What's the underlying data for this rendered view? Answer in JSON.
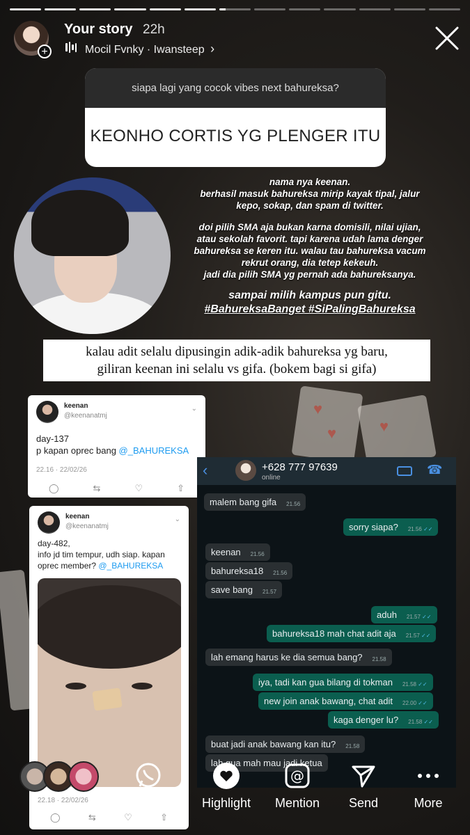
{
  "header": {
    "title": "Your story",
    "time": "22h",
    "music": "Mocil Fvnky · Iwansteep",
    "music_chevron": "›"
  },
  "progress": {
    "segments": 13,
    "completed": 6,
    "active_fraction": 0.2
  },
  "question_sticker": {
    "question": "siapa lagi yang cocok vibes next bahureksa?",
    "answer": "KEONHO CORTIS YG PLENGER ITU"
  },
  "description": {
    "p1": [
      "nama nya keenan.",
      "berhasil masuk bahureksa mirip kayak tipal, jalur",
      "kepo, sokap, dan spam di twitter."
    ],
    "p2": [
      "doi pilih SMA aja bukan karna domisili, nilai ujian,",
      "atau sekolah favorit. tapi karena udah lama denger",
      "bahureksa se keren itu. walau tau bahureksa vacum",
      "rekrut orang, dia tetep kekeuh.",
      "jadi dia pilih SMA yg pernah ada bahureksanya."
    ],
    "p3": "sampai milih kampus pun gitu.",
    "tags": "#BahureksaBanget #SiPalingBahureksa"
  },
  "caption": [
    "kalau adit selalu dipusingin adik-adik bahureksa yg baru,",
    "giliran keenan ini selalu vs gifa. (bokem bagi si gifa)"
  ],
  "tweet1": {
    "name": "keenan",
    "handle": "@keenanatmj",
    "line1": "day-137",
    "text": "p kapan oprec bang ",
    "mention": "@_BAHUREKSA",
    "meta": "22.16 · 22/02/26"
  },
  "tweet2": {
    "name": "keenan",
    "handle": "@keenanatmj",
    "line1": "day-482,",
    "line2": "info jd tim tempur, udh siap. kapan",
    "line3": "oprec member? ",
    "mention": "@_BAHUREKSA",
    "meta": "22.18 · 22/02/26"
  },
  "whatsapp": {
    "number": "+628 777 97639",
    "status": "online",
    "messages": [
      {
        "text": "malem bang gifa",
        "time": "21.56"
      },
      {
        "text": "sorry siapa?",
        "time": "21.56"
      },
      {
        "text": "keenan",
        "time": "21.56"
      },
      {
        "text": "bahureksa18",
        "time": "21.56"
      },
      {
        "text": "save bang",
        "time": "21.57"
      },
      {
        "text": "aduh",
        "time": "21.57"
      },
      {
        "text": "bahureksa18 mah chat adit aja",
        "time": "21.57"
      },
      {
        "text": "lah emang harus ke dia semua bang?",
        "time": "21.58"
      },
      {
        "text": "iya, tadi kan gua bilang di tokman",
        "time": "21.58"
      },
      {
        "text": "new join anak bawang, chat adit",
        "time": "22.00"
      },
      {
        "text": "kaga denger lu?",
        "time": "21.58"
      },
      {
        "text": "buat jadi anak bawang kan itu?",
        "time": "21.58"
      },
      {
        "text": "lah gua mah mau jadi ketua",
        "time": ""
      }
    ]
  },
  "actions": {
    "highlight": "Highlight",
    "mention": "Mention",
    "send": "Send",
    "more": "More"
  },
  "colors": {
    "wa_out": "#0b5e4f",
    "wa_in": "#2a2f32",
    "link": "#1d9bf0"
  }
}
